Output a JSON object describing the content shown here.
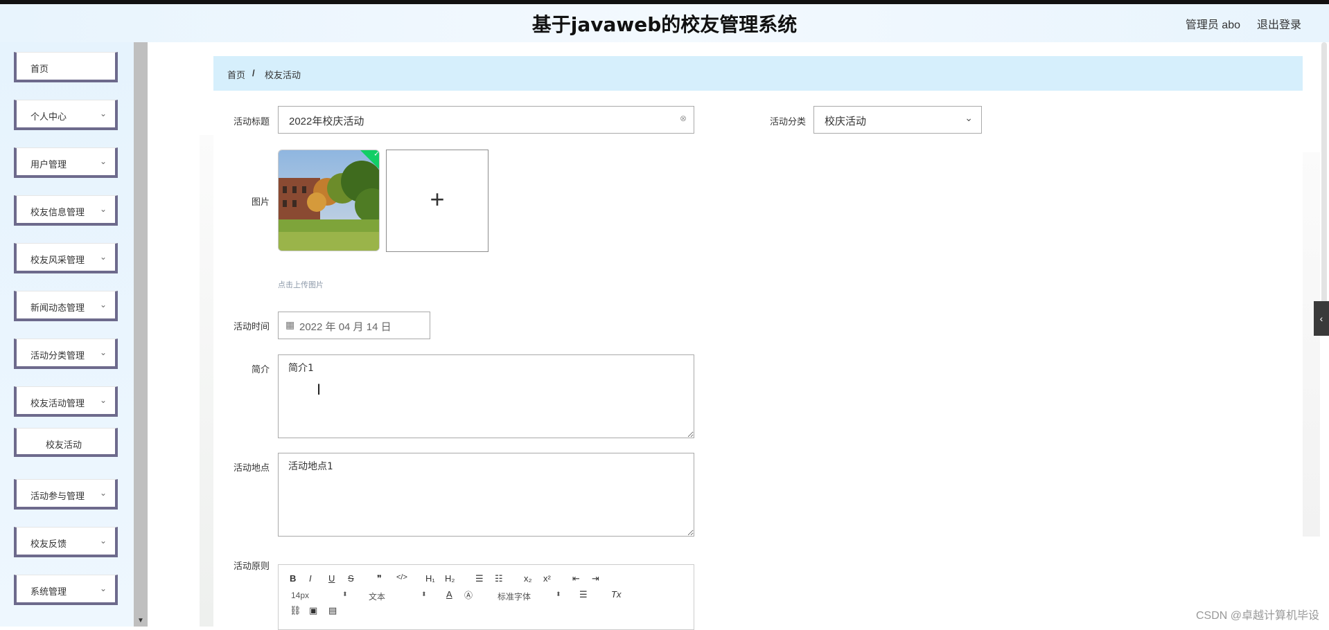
{
  "header": {
    "title": "基于javaweb的校友管理系统",
    "user": "管理员 abo",
    "logout": "退出登录"
  },
  "sidebar": {
    "items": [
      {
        "label": "首页",
        "has_chevron": false
      },
      {
        "label": "个人中心",
        "has_chevron": true
      },
      {
        "label": "用户管理",
        "has_chevron": true
      },
      {
        "label": "校友信息管理",
        "has_chevron": true
      },
      {
        "label": "校友风采管理",
        "has_chevron": true
      },
      {
        "label": "新闻动态管理",
        "has_chevron": true
      },
      {
        "label": "活动分类管理",
        "has_chevron": true
      },
      {
        "label": "校友活动管理",
        "has_chevron": true
      },
      {
        "label": "校友活动",
        "has_chevron": false,
        "submenu": true
      },
      {
        "label": "活动参与管理",
        "has_chevron": true
      },
      {
        "label": "校友反馈",
        "has_chevron": true
      },
      {
        "label": "系统管理",
        "has_chevron": true
      }
    ],
    "chevron_glyph": "⌄"
  },
  "breadcrumb": {
    "home": "首页",
    "separator": "/",
    "current": "校友活动"
  },
  "form": {
    "title_label": "活动标题",
    "title_value": "2022年校庆活动",
    "category_label": "活动分类",
    "category_value": "校庆活动",
    "image_label": "图片",
    "upload_hint": "点击上传图片",
    "time_label": "活动时间",
    "time_value": "2022 年 04 月 14 日",
    "intro_label": "简介",
    "intro_value": "简介1",
    "location_label": "活动地点",
    "location_value": "活动地点1",
    "rules_label": "活动原则"
  },
  "editor": {
    "row1": [
      "B",
      "I",
      "U",
      "S",
      "❞",
      "</>",
      "H₁",
      "H₂",
      "☰",
      "☷",
      "x₂",
      "x²",
      "⇤",
      "⇥"
    ],
    "font_size": "14px",
    "block_type": "文本",
    "font_family": "标准字体",
    "row3_icons": [
      "link-icon",
      "image-icon",
      "video-icon"
    ]
  },
  "watermark": "CSDN @卓越计算机毕设",
  "colors": {
    "accent_border": "#6d6a8c",
    "breadcrumb_bg": "#d6effc",
    "check_green": "#13ce66"
  }
}
